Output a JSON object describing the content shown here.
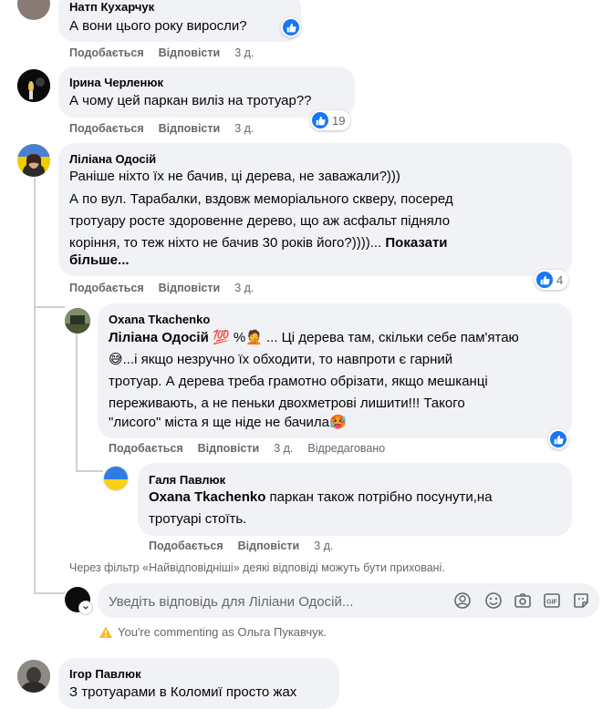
{
  "comments": {
    "c1": {
      "author": "Натп Кухарчук",
      "text": "А вони цього року виросли?",
      "like": "Подобається",
      "reply": "Відповісти",
      "time": "3 д."
    },
    "c2": {
      "author": "Ірина Черленюк",
      "text": "А чому цей паркан виліз на тротуар??",
      "like": "Подобається",
      "reply": "Відповісти",
      "time": "3 д.",
      "reactions": "19"
    },
    "c3": {
      "author": "Ліліана Одосій",
      "line1": "Раніше ніхто їх не бачив, ці дерева, не заважали?)))",
      "line2": "А по вул. Тарабалки, вздовж меморіального скверу, посеред",
      "line3": "тротуару росте здоровенне дерево, що аж асфальт підняло",
      "line4": "коріння, то теж ніхто не бачив 30 років його?))))...",
      "more": "Показати",
      "more2": "більше...",
      "like": "Подобається",
      "reply": "Відповісти",
      "time": "3 д.",
      "reactions": "4"
    },
    "r1": {
      "author": "Oxana Tkachenko",
      "mention": "Ліліана Одосій",
      "emoji_tail": "💯 %🤦 ...",
      "line1_rest": " Ці дерева там, скільки себе пам'ятаю",
      "line2": "😅...і якщо незручно їх обходити, то навпроти є гарний",
      "line3": "тротуар. А дерева треба грамотно обрізати, якщо мешканці",
      "line4": "переживають, а не пеньки двохметрові лишити!!! Такого",
      "line5": "\"лисого\" міста я ще ніде не бачила🥵",
      "like": "Подобається",
      "reply": "Відповісти",
      "time": "3 д.",
      "edited": "Відредаговано"
    },
    "r2": {
      "author": "Галя Павлюк",
      "mention": "Oxana Tkachenko",
      "line1_rest": " паркан також потрібно посунути,на",
      "line2": "тротуарі стоїть.",
      "like": "Подобається",
      "reply": "Відповісти",
      "time": "3 д."
    },
    "c4": {
      "author": "Ігор Павлюк",
      "text": "З тротуарами в Коломиї просто жах"
    }
  },
  "filter_notice": "Через фільтр «Найвідповідніші» деякі відповіді можуть бути приховані.",
  "reply_box": {
    "placeholder": "Уведіть відповідь для Ліліани Одосій..."
  },
  "commenting_as": "You're commenting as Ольга Пукавчук.",
  "colors": {
    "bubble": "#f0f2f5",
    "link_gray": "#65676b",
    "like_blue": "#1877f2"
  },
  "icons": [
    "like-icon",
    "emoji-icon",
    "camera-icon",
    "gif-icon",
    "sticker-icon",
    "warning-icon"
  ]
}
